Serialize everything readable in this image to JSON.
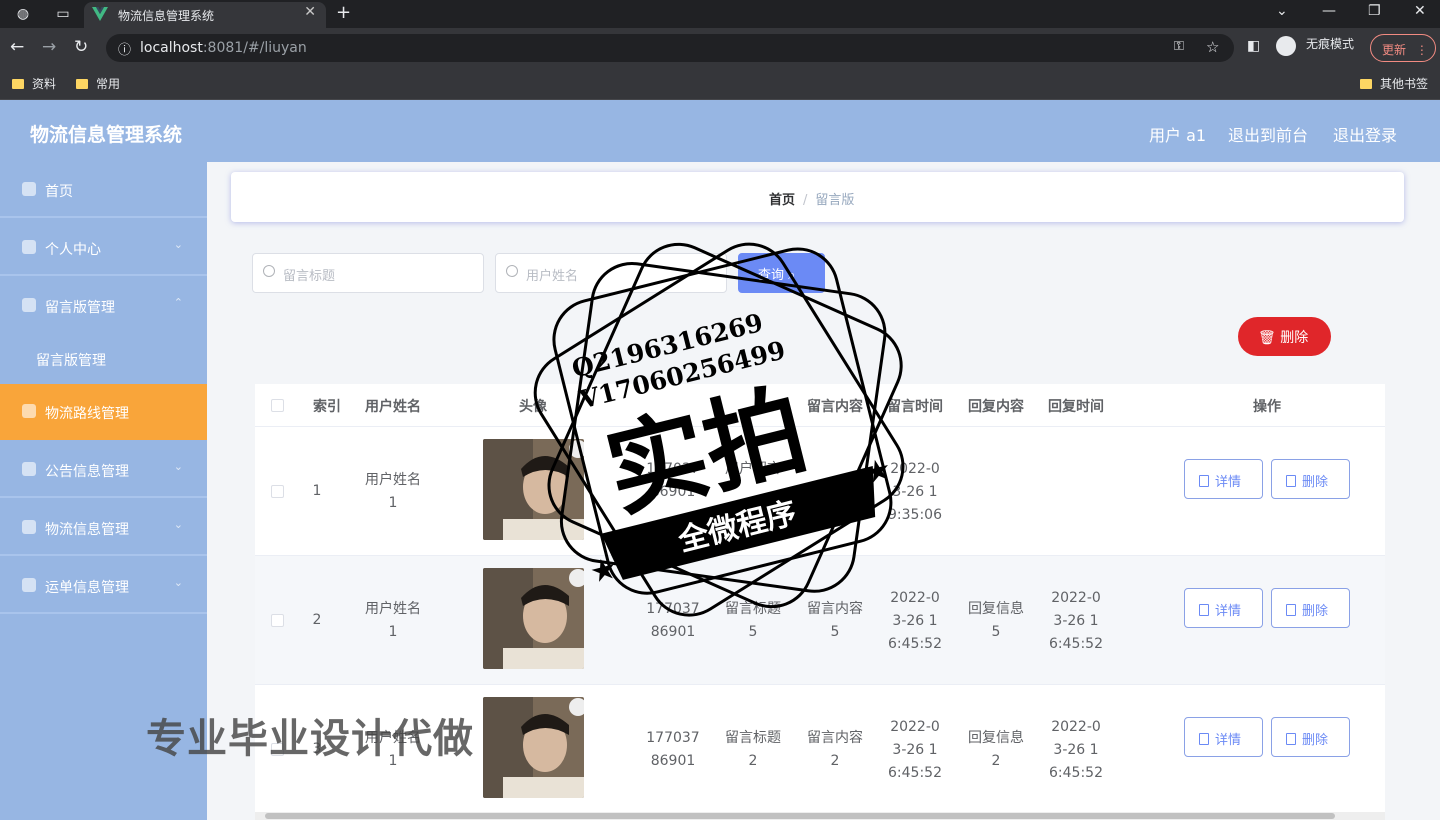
{
  "browser": {
    "tab_title": "物流信息管理系统",
    "url_host": "localhost",
    "url_rest": ":8081/#/liuyan",
    "incognito_label": "无痕模式",
    "update_label": "更新",
    "bookmarks": [
      "资料",
      "常用"
    ],
    "other_bookmarks": "其他书签"
  },
  "header": {
    "title": "物流信息管理系统",
    "user": "用户 a1",
    "back_front": "退出到前台",
    "logout": "退出登录"
  },
  "sidebar": {
    "items": [
      {
        "label": "首页",
        "icon": "home-icon"
      },
      {
        "label": "个人中心",
        "icon": "user-icon"
      },
      {
        "label": "留言版管理",
        "icon": "lock-icon"
      },
      {
        "label": "物流路线管理",
        "icon": "user-icon"
      },
      {
        "label": "公告信息管理",
        "icon": "user-icon"
      },
      {
        "label": "物流信息管理",
        "icon": "doc-icon"
      },
      {
        "label": "运单信息管理",
        "icon": "send-icon"
      }
    ],
    "submenu_label": "留言版管理",
    "active_index": 3
  },
  "breadcrumb": {
    "home": "首页",
    "current": "留言版"
  },
  "search": {
    "title_placeholder": "留言标题",
    "name_placeholder": "用户姓名",
    "button": "查询"
  },
  "toolbar": {
    "delete_label": "删除"
  },
  "table": {
    "headers": [
      "索引",
      "用户姓名",
      "头像",
      "",
      "",
      "留言内容",
      "留言时间",
      "回复内容",
      "回复时间",
      "操作"
    ],
    "rows": [
      {
        "index": "1",
        "name": "用户姓名1",
        "phone": "17703786901",
        "title": "用户留言",
        "content": "",
        "time": "2022-03-26 19:35:06",
        "reply": "",
        "reply_time": ""
      },
      {
        "index": "2",
        "name": "用户姓名1",
        "phone": "17703786901",
        "title": "留言标题5",
        "content": "留言内容5",
        "time": "2022-03-26 16:45:52",
        "reply": "回复信息5",
        "reply_time": "2022-03-26 16:45:52"
      },
      {
        "index": "3",
        "name": "用户姓名1",
        "phone": "17703786901",
        "title": "留言标题2",
        "content": "留言内容2",
        "time": "2022-03-26 16:45:52",
        "reply": "回复信息2",
        "reply_time": "2022-03-26 16:45:52"
      }
    ],
    "detail_label": "详情",
    "delete_label": "删除"
  },
  "watermark": {
    "qq": "Q2196316269",
    "v": "V17060256499",
    "big": "实拍",
    "banner": "全微程序",
    "bottom": "专业毕业设计代做"
  }
}
